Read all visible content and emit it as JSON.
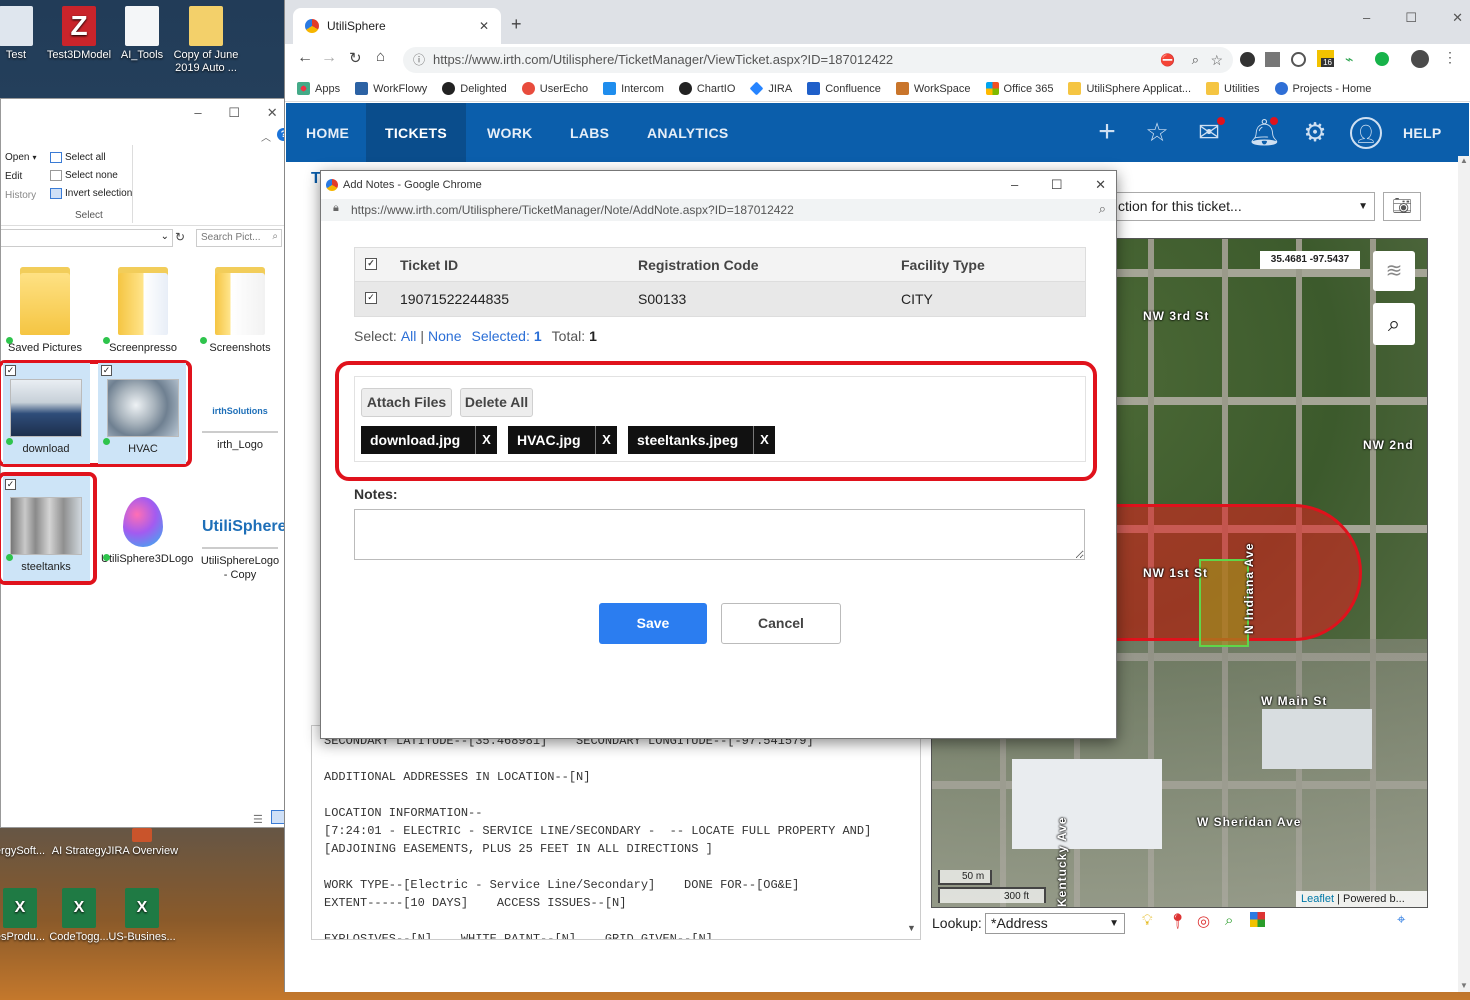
{
  "desktop": {
    "icons_top": [
      {
        "label": "Test"
      },
      {
        "label": "Test3DModel"
      },
      {
        "label": "AI_Tools"
      },
      {
        "label": "Copy of June 2019 Auto ..."
      }
    ],
    "icons_lower": [
      {
        "label": "ergySoft..."
      },
      {
        "label": "AI Strategy"
      },
      {
        "label": "JIRA Overview"
      }
    ],
    "icons_bottom": [
      {
        "label": "esProdu..."
      },
      {
        "label": "CodeTogg..."
      },
      {
        "label": "US-Busines..."
      }
    ]
  },
  "explorer": {
    "ribbon": {
      "open": "Open",
      "edit": "Edit",
      "history": "History",
      "select_all": "Select all",
      "select_none": "Select none",
      "invert_selection": "Invert selection",
      "group_label": "Select"
    },
    "search_placeholder": "Search Pict...",
    "items": [
      {
        "label": "Saved Pictures"
      },
      {
        "label": "Screenpresso"
      },
      {
        "label": "Screenshots"
      },
      {
        "label": "download"
      },
      {
        "label": "HVAC"
      },
      {
        "label": "irth_Logo"
      },
      {
        "label": "steeltanks"
      },
      {
        "label": "UtiliSphere3DLogo"
      },
      {
        "label": "UtiliSphereLogo - Copy"
      }
    ],
    "logo_text_irth": "irthSolutions",
    "logo_text_utili": "UtiliSphere"
  },
  "browser": {
    "tab_title": "UtiliSphere",
    "url": "https://www.irth.com/Utilisphere/TicketManager/ViewTicket.aspx?ID=187012422",
    "badge_count": "16",
    "bookmarks": [
      "Apps",
      "WorkFlowy",
      "Delighted",
      "UserEcho",
      "Intercom",
      "ChartIO",
      "JIRA",
      "Confluence",
      "WorkSpace",
      "Office 365",
      "UtiliSphere Applicat...",
      "Utilities",
      "Projects - Home"
    ],
    "colors": {
      "nav": "#0b5eab",
      "active_nav": "#0a4d8c",
      "save": "#2b7df0",
      "highlight": "#e0121c"
    }
  },
  "app": {
    "nav": [
      "HOME",
      "TICKETS",
      "WORK",
      "LABS",
      "ANALYTICS"
    ],
    "active_nav": "TICKETS",
    "help": "HELP",
    "page_heading_fragment": "T",
    "action_select": "ction for this ticket...",
    "ticket_text": "SECONDARY LATITUDE--[35.468981]    SECONDARY LONGITUDE--[-97.541579]\n\nADDITIONAL ADDRESSES IN LOCATION--[N]\n\nLOCATION INFORMATION--\n[7:24:01 - ELECTRIC - SERVICE LINE/SECONDARY -  -- LOCATE FULL PROPERTY AND]\n[ADJOINING EASEMENTS, PLUS 25 FEET IN ALL DIRECTIONS ]\n\nWORK TYPE--[Electric - Service Line/Secondary]    DONE FOR--[OG&E]\nEXTENT-----[10 DAYS]    ACCESS ISSUES--[N]\n\nEXPLOSIVES--[N]    WHITE PAINT--[N]    GRID GIVEN--[N]",
    "map": {
      "coords": "35.4681 -97.5437",
      "streets": [
        "NW 3rd St",
        "NW 2nd",
        "NW 1st St",
        "N Indiana Ave",
        "W Main St",
        "W Sheridan Ave",
        "Kentucky Ave"
      ],
      "scale_m": "50 m",
      "scale_ft": "300 ft",
      "attribution_link": "Leaflet",
      "attribution_rest": "| Powered b..."
    },
    "lookup_label": "Lookup:",
    "lookup_value": "*Address"
  },
  "dialog": {
    "window_title": "Add Notes - Google Chrome",
    "url": "https://www.irth.com/Utilisphere/TicketManager/Note/AddNote.aspx?ID=187012422",
    "columns": [
      "Ticket ID",
      "Registration Code",
      "Facility Type"
    ],
    "row": {
      "ticket_id": "19071522244835",
      "registration_code": "S00133",
      "facility_type": "CITY"
    },
    "select_label": "Select:",
    "all": "All",
    "sep": "|",
    "none": "None",
    "selected_label": "Selected:",
    "selected_count": "1",
    "total_label": "Total:",
    "total_count": "1",
    "attach_files": "Attach Files",
    "delete_all": "Delete All",
    "files": [
      "download.jpg",
      "HVAC.jpg",
      "steeltanks.jpeg"
    ],
    "remove_glyph": "X",
    "notes_label": "Notes:",
    "notes_value": "",
    "save": "Save",
    "cancel": "Cancel"
  }
}
